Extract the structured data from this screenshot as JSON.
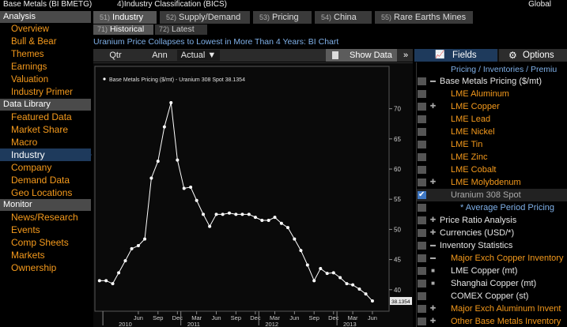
{
  "header": {
    "title": "Base Metals (BI BMETG)",
    "industry_num": "4)",
    "industry_label": "Industry Classification (BICS)",
    "region": "Global"
  },
  "sidebar": {
    "analysis_header": "Analysis",
    "analysis_items": [
      "Overview",
      "Bull & Bear",
      "Themes",
      "Earnings",
      "Valuation",
      "Industry Primer"
    ],
    "library_header": "Data Library",
    "library_items": [
      "Featured Data",
      "Market Share",
      "Macro",
      "Industry",
      "Company",
      "Demand Data",
      "Geo Locations"
    ],
    "monitor_header": "Monitor",
    "monitor_items": [
      "News/Research",
      "Events",
      "Comp Sheets",
      "Markets",
      "Ownership"
    ],
    "active_item": "Industry"
  },
  "tabs": [
    {
      "num": "51)",
      "label": "Industry",
      "active": true
    },
    {
      "num": "52)",
      "label": "Supply/Demand",
      "active": false
    },
    {
      "num": "53)",
      "label": "Pricing",
      "active": false
    },
    {
      "num": "54)",
      "label": "China",
      "active": false
    },
    {
      "num": "55)",
      "label": "Rare Earths Mines",
      "active": false
    }
  ],
  "subtabs": [
    {
      "num": "71)",
      "label": "Historical",
      "active": true
    },
    {
      "num": "72)",
      "label": "Latest",
      "active": false
    }
  ],
  "headline": "Uranium Price Collapses to Lowest in More Than 4 Years: BI Chart",
  "chart_toolbar": {
    "qtr": "Qtr",
    "ann": "Ann",
    "actual": "Actual",
    "dropdown_arrow": "▼",
    "show_data": "Show Data",
    "expand": "»"
  },
  "right_toolbar": {
    "fields": "Fields",
    "options": "Options"
  },
  "fields_panel": {
    "breadcrumb": "Pricing / Inventories / Premiu",
    "rows": [
      {
        "label": "Base Metals Pricing ($/mt)",
        "color": "white",
        "toggle": "minus",
        "indent": 0,
        "checked": false
      },
      {
        "label": "LME Aluminum",
        "color": "orange",
        "toggle": "",
        "indent": 2,
        "checked": false
      },
      {
        "label": "LME Copper",
        "color": "orange",
        "toggle": "plus",
        "indent": 2,
        "checked": false
      },
      {
        "label": "LME Lead",
        "color": "orange",
        "toggle": "",
        "indent": 2,
        "checked": false
      },
      {
        "label": "LME Nickel",
        "color": "orange",
        "toggle": "",
        "indent": 2,
        "checked": false
      },
      {
        "label": "LME Tin",
        "color": "orange",
        "toggle": "",
        "indent": 2,
        "checked": false
      },
      {
        "label": "LME Zinc",
        "color": "orange",
        "toggle": "",
        "indent": 2,
        "checked": false
      },
      {
        "label": "LME Cobalt",
        "color": "orange",
        "toggle": "",
        "indent": 2,
        "checked": false
      },
      {
        "label": "LME Molybdenum",
        "color": "orange",
        "toggle": "plus",
        "indent": 2,
        "checked": false
      },
      {
        "label": "Uranium 308 Spot",
        "color": "gray",
        "toggle": "",
        "indent": 2,
        "checked": true
      },
      {
        "label": "* Average Period Pricing",
        "color": "blue",
        "toggle": "",
        "indent": 3,
        "checked": false
      },
      {
        "label": "Price Ratio Analysis",
        "color": "white",
        "toggle": "plus",
        "indent": 0,
        "checked": false
      },
      {
        "label": "Currencies (USD/*)",
        "color": "white",
        "toggle": "plus",
        "indent": 0,
        "checked": false
      },
      {
        "label": "Inventory Statistics",
        "color": "white",
        "toggle": "minus",
        "indent": 0,
        "checked": false
      },
      {
        "label": "Major Exch Copper Inventory",
        "color": "orange",
        "toggle": "minus",
        "indent": 1,
        "checked": false
      },
      {
        "label": "LME Copper (mt)",
        "color": "white",
        "toggle": "sq",
        "indent": 2,
        "checked": false
      },
      {
        "label": "Shanghai Copper (mt)",
        "color": "white",
        "toggle": "sq",
        "indent": 2,
        "checked": false
      },
      {
        "label": "COMEX Copper (st)",
        "color": "white",
        "toggle": "",
        "indent": 2,
        "checked": false
      },
      {
        "label": "Major Exch Aluminum Invent",
        "color": "orange",
        "toggle": "plus",
        "indent": 1,
        "checked": false
      },
      {
        "label": "Other Base Metals Inventory",
        "color": "orange",
        "toggle": "plus",
        "indent": 1,
        "checked": false
      }
    ]
  },
  "colors": {
    "accent_orange": "#f59a1c",
    "link_blue": "#7fb0e8",
    "active_blue": "#1e3a5c",
    "series": "#ffffff"
  },
  "chart_data": {
    "type": "line",
    "legend": "Base Metals Pricing ($/mt) - Uranium 308 Spot 38.1354",
    "last_value_label": "38.1354",
    "y_ticks": [
      40,
      45,
      50,
      55,
      60,
      65,
      70
    ],
    "ylim": [
      36.7,
      76.5
    ],
    "x_month_ticks": [
      "Jun",
      "Sep",
      "Dec",
      "Mar",
      "Jun",
      "Sep",
      "Dec",
      "Mar",
      "Jun",
      "Sep",
      "Dec",
      "Mar",
      "Jun"
    ],
    "x_year_labels": [
      "2010",
      "2011",
      "2012",
      "2013"
    ],
    "x_start": "2009-12",
    "x_end": "2013-09",
    "series": [
      {
        "name": "Uranium 308 Spot",
        "x": [
          "2009-12-15",
          "2010-01-15",
          "2010-02-15",
          "2010-03-15",
          "2010-04-15",
          "2010-05-15",
          "2010-06-15",
          "2010-07-15",
          "2010-08-15",
          "2010-09-15",
          "2010-10-15",
          "2010-11-15",
          "2010-12-15",
          "2011-01-15",
          "2011-02-15",
          "2011-03-15",
          "2011-04-15",
          "2011-05-15",
          "2011-06-15",
          "2011-07-15",
          "2011-08-15",
          "2011-09-15",
          "2011-10-15",
          "2011-11-15",
          "2011-12-15",
          "2012-01-15",
          "2012-02-15",
          "2012-03-15",
          "2012-04-15",
          "2012-05-15",
          "2012-06-15",
          "2012-07-15",
          "2012-08-15",
          "2012-09-15",
          "2012-10-15",
          "2012-11-15",
          "2012-12-15",
          "2013-01-15",
          "2013-02-15",
          "2013-03-15",
          "2013-04-15",
          "2013-05-15",
          "2013-06-15",
          "2013-07-15",
          "2013-08-15"
        ],
        "values": [
          41.5,
          41.5,
          41.0,
          42.8,
          44.8,
          46.8,
          47.3,
          48.4,
          58.5,
          61.3,
          67.0,
          71.0,
          61.5,
          56.8,
          57.0,
          54.8,
          52.5,
          50.5,
          52.5,
          52.5,
          52.7,
          52.5,
          52.5,
          52.5,
          52.0,
          51.5,
          51.5,
          52.0,
          51.0,
          50.3,
          48.4,
          46.5,
          44.1,
          41.5,
          43.5,
          42.7,
          42.8,
          42.0,
          41.0,
          40.8,
          40.1,
          39.3,
          38.1354,
          null,
          null
        ]
      }
    ]
  }
}
